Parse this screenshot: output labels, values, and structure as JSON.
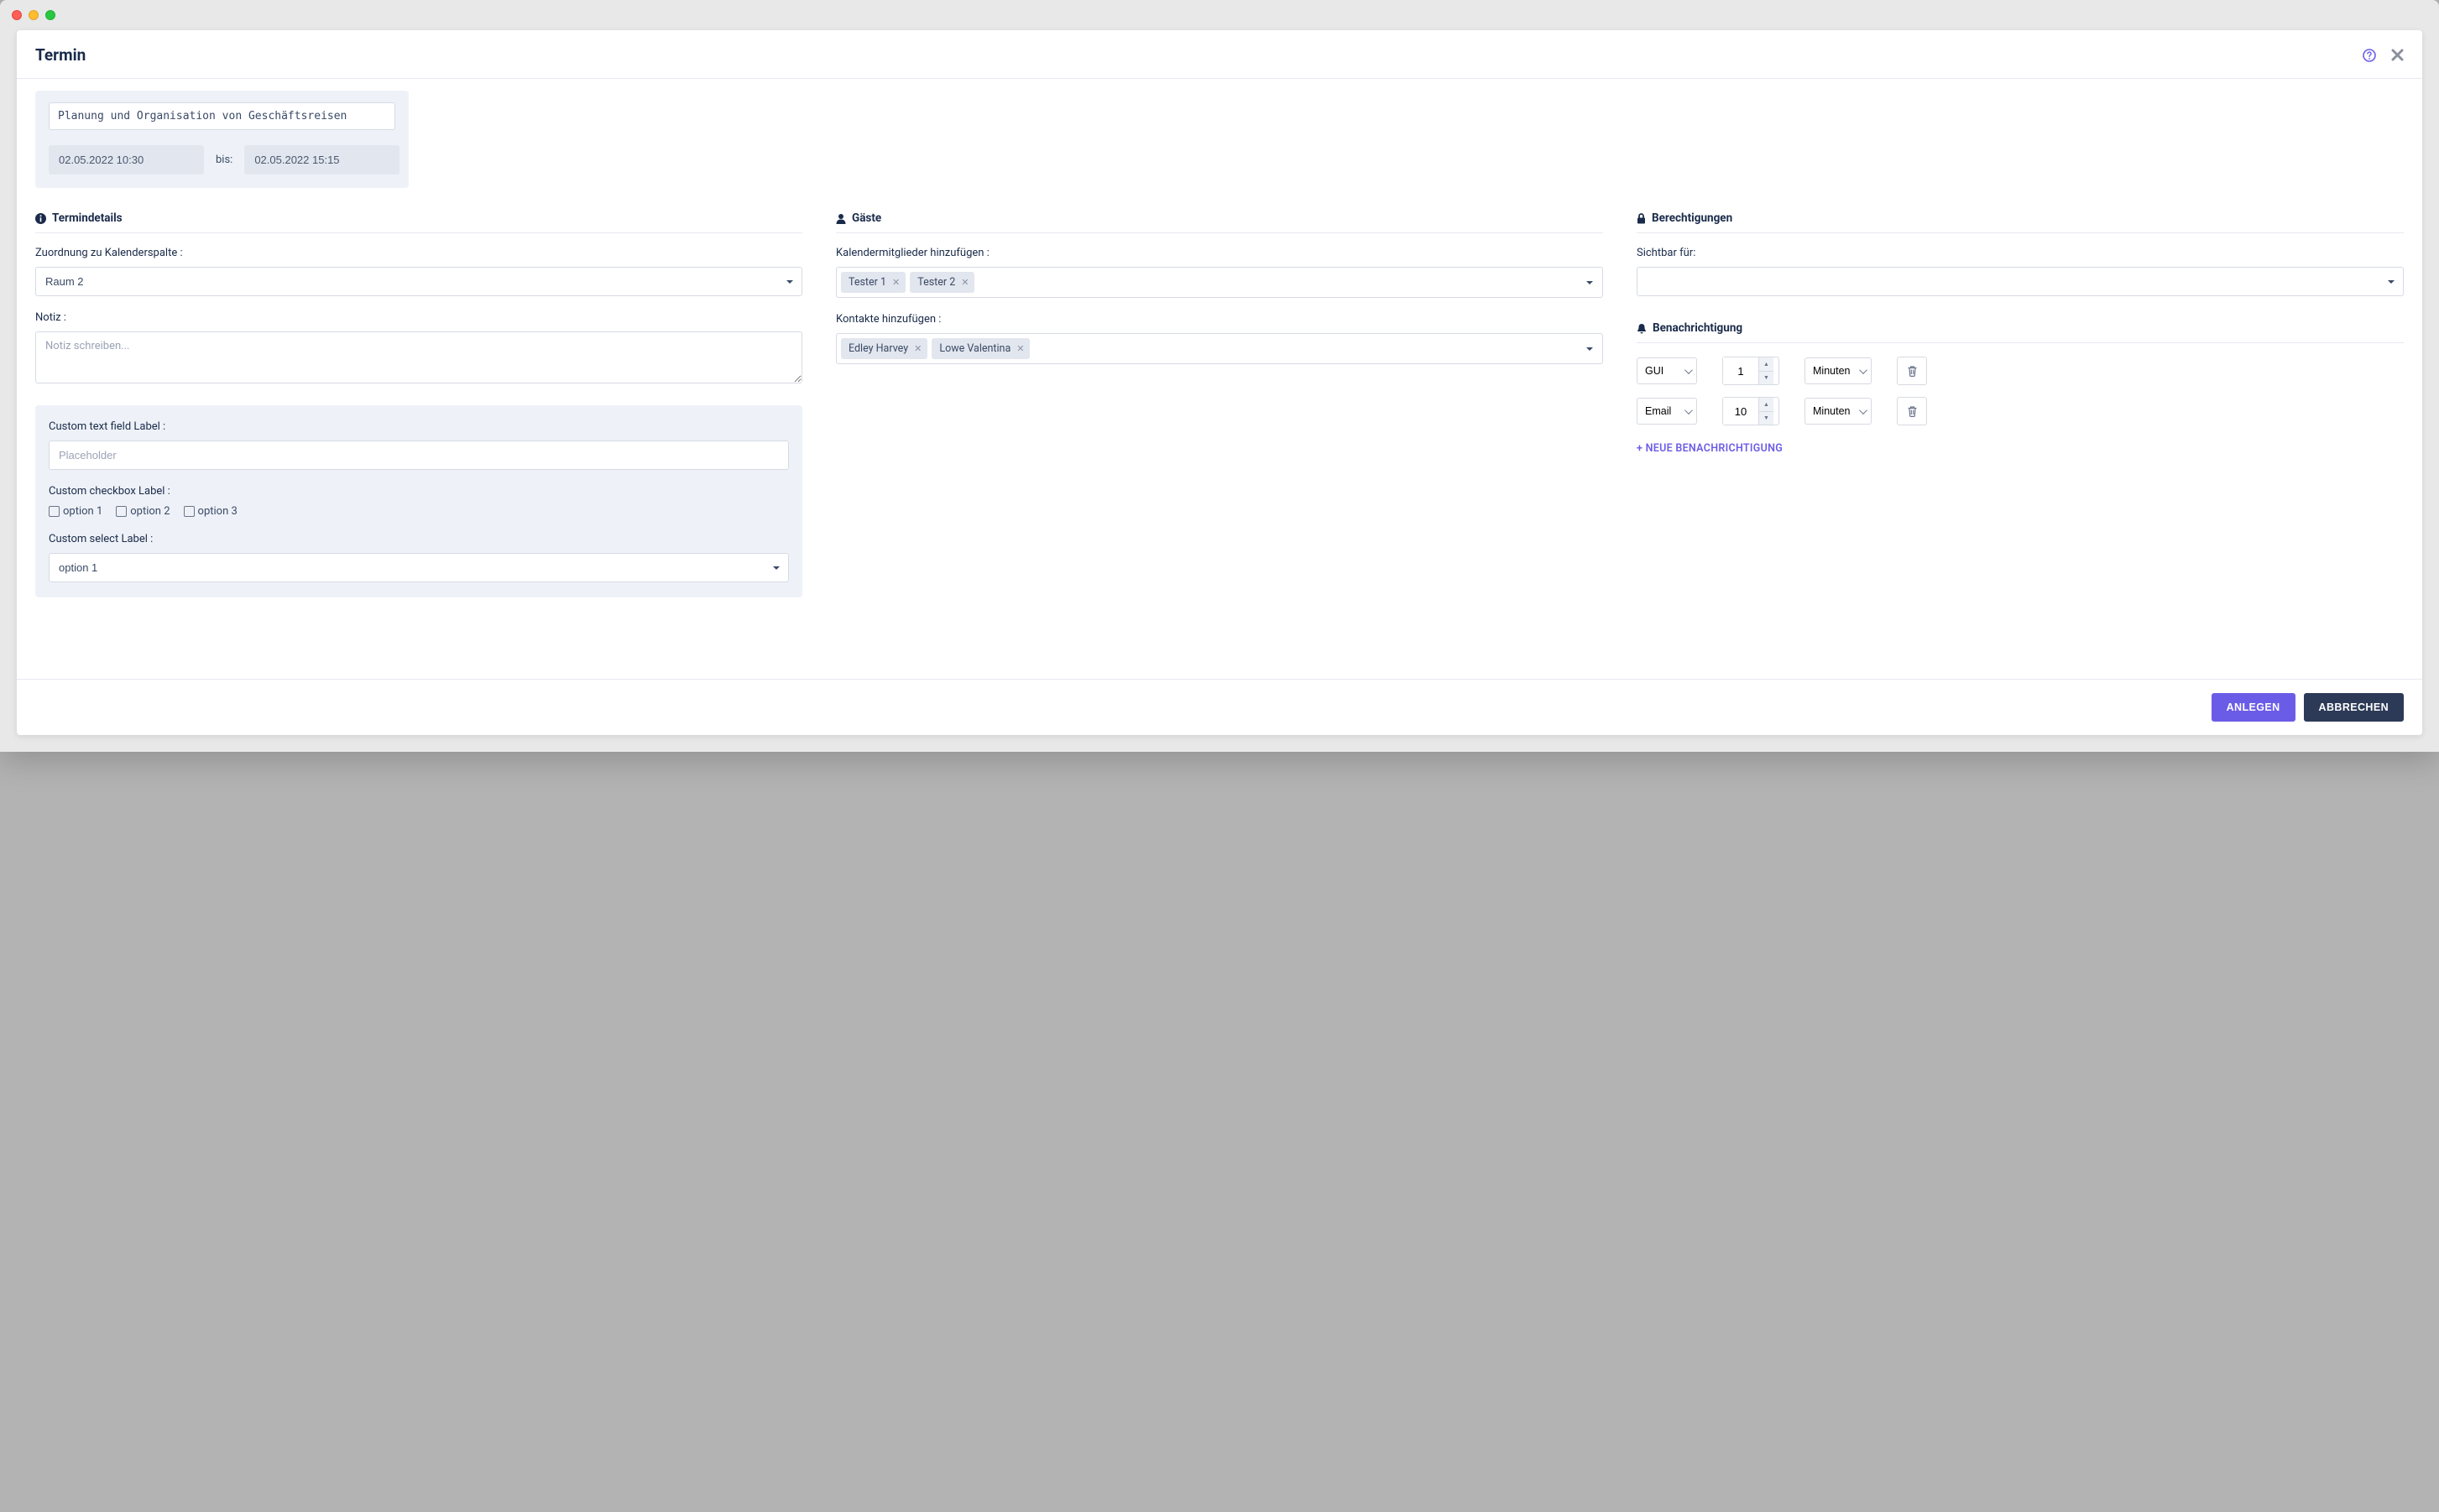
{
  "modal": {
    "title": "Termin",
    "top": {
      "title_value": "Planung und Organisation von Geschäftsreisen",
      "date_from": "02.05.2022 10:30",
      "date_sep": "bis:",
      "date_to": "02.05.2022 15:15"
    }
  },
  "details": {
    "header": "Termindetails",
    "assign_label": "Zuordnung zu Kalenderspalte :",
    "assign_value": "Raum 2",
    "note_label": "Notiz :",
    "note_placeholder": "Notiz schreiben...",
    "custom_text_label": "Custom text field Label :",
    "custom_text_placeholder": "Placeholder",
    "custom_checkbox_label": "Custom checkbox Label :",
    "custom_checkbox_options": [
      "option 1",
      "option 2",
      "option 3"
    ],
    "custom_select_label": "Custom select Label :",
    "custom_select_value": "option 1"
  },
  "guests": {
    "header": "Gäste",
    "members_label": "Kalendermitglieder hinzufügen :",
    "members": [
      "Tester 1",
      "Tester 2"
    ],
    "contacts_label": "Kontakte hinzufügen :",
    "contacts": [
      "Edley Harvey",
      "Lowe Valentina"
    ]
  },
  "permissions": {
    "header": "Berechtigungen",
    "visible_label": "Sichtbar für:"
  },
  "notifications": {
    "header": "Benachrichtigung",
    "rows": [
      {
        "type": "GUI",
        "num": "1",
        "unit": "Minuten"
      },
      {
        "type": "Email",
        "num": "10",
        "unit": "Minuten"
      }
    ],
    "add_text": "+ NEUE BENACHRICHTIGUNG"
  },
  "footer": {
    "primary": "ANLEGEN",
    "secondary": "ABBRECHEN"
  }
}
